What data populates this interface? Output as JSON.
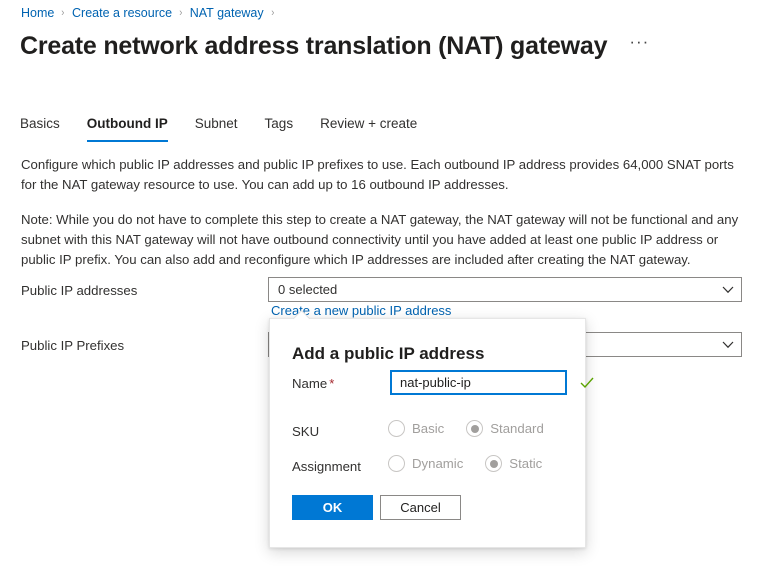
{
  "breadcrumb": {
    "items": [
      {
        "label": "Home"
      },
      {
        "label": "Create a resource"
      },
      {
        "label": "NAT gateway"
      }
    ],
    "separator": "›"
  },
  "header": {
    "title": "Create network address translation (NAT) gateway",
    "more_label": "···"
  },
  "tabs": [
    {
      "label": "Basics",
      "active": false
    },
    {
      "label": "Outbound IP",
      "active": true
    },
    {
      "label": "Subnet",
      "active": false
    },
    {
      "label": "Tags",
      "active": false
    },
    {
      "label": "Review + create",
      "active": false
    }
  ],
  "main": {
    "paragraph_1": "Configure which public IP addresses and public IP prefixes to use. Each outbound IP address provides 64,000 SNAT ports for the NAT gateway resource to use. You can add up to 16 outbound IP addresses.",
    "paragraph_2": "Note: While you do not have to complete this step to create a NAT gateway, the NAT gateway will not be functional and any subnet with this NAT gateway will not have outbound connectivity until you have added at least one public IP address or public IP prefix. You can also add and reconfigure which IP addresses are included after creating the NAT gateway.",
    "fields": {
      "public_ip_addresses": {
        "label": "Public IP addresses",
        "value": "0 selected",
        "link_label": "Create a new public IP address"
      },
      "public_ip_prefixes": {
        "label": "Public IP Prefixes",
        "value": ""
      }
    }
  },
  "callout": {
    "title": "Add a public IP address",
    "name": {
      "label": "Name",
      "required_marker": "*",
      "value": "nat-public-ip",
      "placeholder": "",
      "valid_icon": "checkmark-icon"
    },
    "sku": {
      "label": "SKU",
      "options": [
        {
          "label": "Basic",
          "selected": false
        },
        {
          "label": "Standard",
          "selected": true
        }
      ]
    },
    "assignment": {
      "label": "Assignment",
      "options": [
        {
          "label": "Dynamic",
          "selected": false
        },
        {
          "label": "Static",
          "selected": true
        }
      ]
    },
    "ok_label": "OK",
    "cancel_label": "Cancel"
  },
  "colors": {
    "accent": "#0078d4",
    "link": "#0063b1",
    "required": "#a4262c",
    "valid": "#5aa300",
    "text": "#323130",
    "disabled_text": "#a19f9d"
  }
}
